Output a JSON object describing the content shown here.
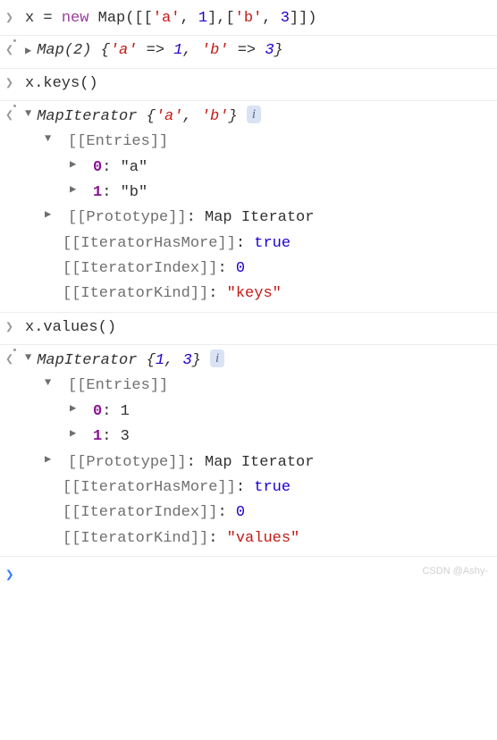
{
  "input1": {
    "var": "x",
    "eq": " = ",
    "kw": "new",
    "call": " Map([[",
    "s1": "'a'",
    "c1": ", ",
    "n1": "1",
    "b1": "],[",
    "s2": "'b'",
    "c2": ", ",
    "n2": "3",
    "b2": "]])"
  },
  "output1": {
    "label": "Map(2)",
    "lb": " {",
    "k1": "'a'",
    "arr": " => ",
    "v1": "1",
    "sep": ", ",
    "k2": "'b'",
    "v2": "3",
    "rb": "}"
  },
  "input2": {
    "code": "x.keys()"
  },
  "output2": {
    "label": "MapIterator",
    "summary_lb": " {",
    "s1": "'a'",
    "sep": ", ",
    "s2": "'b'",
    "summary_rb": "}",
    "info": "i",
    "entries": "[[Entries]]",
    "idx0": "0",
    "colon": ": ",
    "val0": "\"a\"",
    "idx1": "1",
    "val1": "\"b\"",
    "proto_k": "[[Prototype]]",
    "proto_v": "Map Iterator",
    "hasmore_k": "[[IteratorHasMore]]",
    "hasmore_v": "true",
    "index_k": "[[IteratorIndex]]",
    "index_v": "0",
    "kind_k": "[[IteratorKind]]",
    "kind_v": "\"keys\""
  },
  "input3": {
    "code": "x.values()"
  },
  "output3": {
    "label": "MapIterator",
    "summary_lb": " {",
    "v1": "1",
    "sep": ", ",
    "v2": "3",
    "summary_rb": "}",
    "info": "i",
    "entries": "[[Entries]]",
    "idx0": "0",
    "colon": ": ",
    "val0": "1",
    "idx1": "1",
    "val1": "3",
    "proto_k": "[[Prototype]]",
    "proto_v": "Map Iterator",
    "hasmore_k": "[[IteratorHasMore]]",
    "hasmore_v": "true",
    "index_k": "[[IteratorIndex]]",
    "index_v": "0",
    "kind_k": "[[IteratorKind]]",
    "kind_v": "\"values\""
  },
  "watermark": "CSDN @Ashy-"
}
